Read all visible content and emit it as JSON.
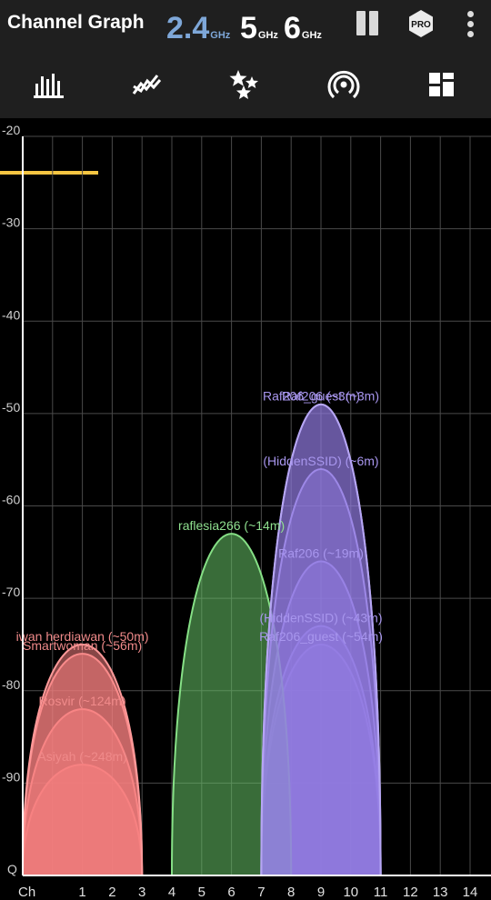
{
  "app": {
    "title": "Channel Graph"
  },
  "bands": [
    {
      "value": "2.4",
      "unit": "GHz",
      "active": true
    },
    {
      "value": "5",
      "unit": "GHz",
      "active": false
    },
    {
      "value": "6",
      "unit": "GHz",
      "active": false
    }
  ],
  "toolbar": {
    "pro_label": "PRO",
    "pause_icon": "pause-icon",
    "menu_icon": "more-vert-icon"
  },
  "tabs": [
    {
      "icon": "bar-chart-icon",
      "active": true
    },
    {
      "icon": "time-graph-icon",
      "active": false
    },
    {
      "icon": "stars-rating-icon",
      "active": false
    },
    {
      "icon": "access-point-icon",
      "active": false
    },
    {
      "icon": "dashboard-grid-icon",
      "active": false
    }
  ],
  "colors": {
    "accent": "#f5c542",
    "band_active": "#7ea7d8",
    "red": "#f08080",
    "green": "#6ecf6e",
    "purple": "#9b86e8"
  },
  "chart_data": {
    "type": "area",
    "x_label": "Ch",
    "x_ticks": [
      "1",
      "2",
      "3",
      "4",
      "5",
      "6",
      "7",
      "8",
      "9",
      "10",
      "11",
      "12",
      "13",
      "14"
    ],
    "x_range": [
      -1,
      15
    ],
    "y_ticks": [
      "-20",
      "-30",
      "-40",
      "-50",
      "-60",
      "-70",
      "-80",
      "-90"
    ],
    "y_bottom_label": "Q",
    "y_range": [
      -100,
      -20
    ],
    "grid": true,
    "networks": [
      {
        "name": "iwan herdiawan (~50m)",
        "channel": 1,
        "level": -75,
        "color": "red"
      },
      {
        "name": "Smartwoman (~56m)",
        "channel": 1,
        "level": -76,
        "color": "red"
      },
      {
        "name": "Rosvir (~124m)",
        "channel": 1,
        "level": -82,
        "color": "red"
      },
      {
        "name": "Asiyah (~248m)",
        "channel": 1,
        "level": -88,
        "color": "red"
      },
      {
        "name": "raflesia266 (~14m)",
        "channel": 6,
        "level": -63,
        "color": "green"
      },
      {
        "name": "Raf206 (~3m)",
        "channel": 9,
        "level": -49,
        "color": "purple"
      },
      {
        "name": "Raf206_guest (~3m)",
        "channel": 9,
        "level": -49,
        "color": "purple"
      },
      {
        "name": "(HiddenSSID) (~6m)",
        "channel": 9,
        "level": -56,
        "color": "purple"
      },
      {
        "name": "Raf206 (~19m)",
        "channel": 9,
        "level": -66,
        "color": "purple"
      },
      {
        "name": "(HiddenSSID) (~43m)",
        "channel": 9,
        "level": -73,
        "color": "purple"
      },
      {
        "name": "Raf206_guest (~54m)",
        "channel": 9,
        "level": -75,
        "color": "purple"
      }
    ]
  }
}
